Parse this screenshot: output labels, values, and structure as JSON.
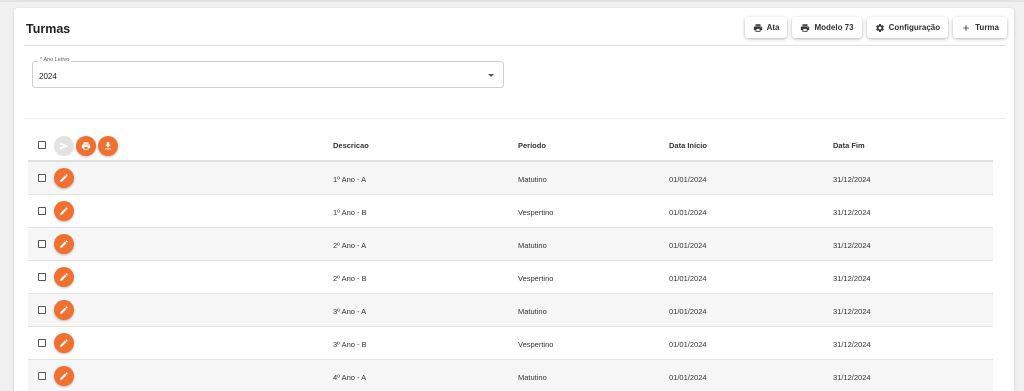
{
  "page": {
    "title": "Turmas"
  },
  "toolbar": {
    "buttons": [
      {
        "label": "Ata",
        "icon": "print-icon"
      },
      {
        "label": "Modelo 73",
        "icon": "print-icon"
      },
      {
        "label": "Configuração",
        "icon": "gear-icon"
      },
      {
        "label": "Turma",
        "icon": "plus-icon"
      }
    ]
  },
  "filter": {
    "label": "* Ano Letivo",
    "value": "2024"
  },
  "table": {
    "columns": [
      "Descricao",
      "Período",
      "Data Início",
      "Data Fim"
    ],
    "header_actions": [
      {
        "icon": "send-icon",
        "enabled": false
      },
      {
        "icon": "print-icon",
        "enabled": true
      },
      {
        "icon": "download-icon",
        "enabled": true
      }
    ],
    "rows": [
      {
        "descricao": "1º Ano - A",
        "periodo": "Matutino",
        "inicio": "01/01/2024",
        "fim": "31/12/2024"
      },
      {
        "descricao": "1º Ano - B",
        "periodo": "Vespertino",
        "inicio": "01/01/2024",
        "fim": "31/12/2024"
      },
      {
        "descricao": "2º Ano - A",
        "periodo": "Matutino",
        "inicio": "01/01/2024",
        "fim": "31/12/2024"
      },
      {
        "descricao": "2º Ano - B",
        "periodo": "Vespertino",
        "inicio": "01/01/2024",
        "fim": "31/12/2024"
      },
      {
        "descricao": "3º Ano - A",
        "periodo": "Matutino",
        "inicio": "01/01/2024",
        "fim": "31/12/2024"
      },
      {
        "descricao": "3º Ano - B",
        "periodo": "Vespertino",
        "inicio": "01/01/2024",
        "fim": "31/12/2024"
      },
      {
        "descricao": "4º Ano - A",
        "periodo": "Matutino",
        "inicio": "01/01/2024",
        "fim": "31/12/2024"
      }
    ]
  },
  "colors": {
    "accent": "#f07030",
    "row_alt": "#f6f6f6"
  }
}
